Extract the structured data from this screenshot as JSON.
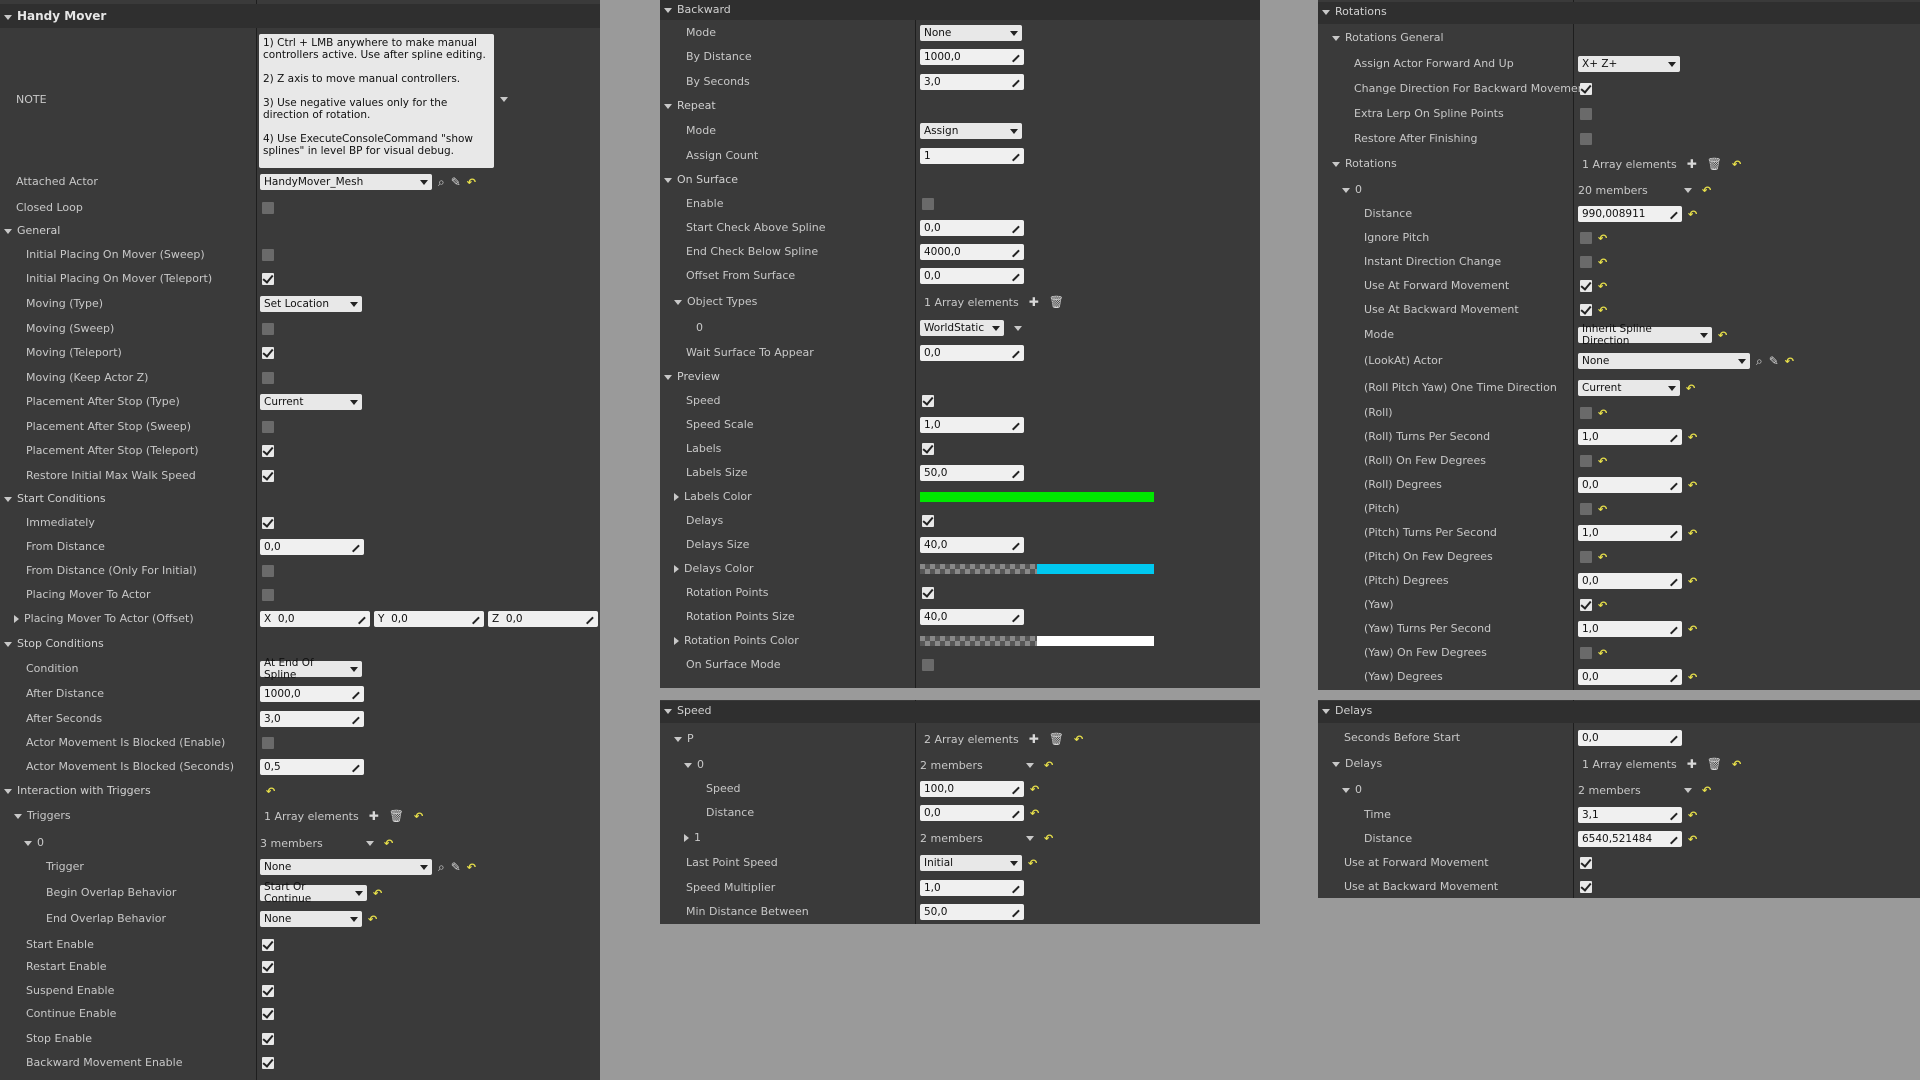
{
  "p1": {
    "title": "Handy Mover",
    "note_label": "NOTE",
    "note_text": "1) Ctrl + LMB anywhere to make manual controllers active. Use after spline editing.\n\n2) Z axis to move manual controllers.\n\n3) Use negative values only for the direction of rotation.\n\n4) Use ExecuteConsoleCommand \"show splines\" in level BP for visual debug.",
    "attached_actor": "Attached Actor",
    "attached_actor_val": "HandyMover_Mesh",
    "closed_loop": "Closed Loop",
    "general": "General",
    "ipm_sweep": "Initial Placing On Mover (Sweep)",
    "ipm_tele": "Initial Placing On Mover (Teleport)",
    "moving_type": "Moving (Type)",
    "moving_type_val": "Set Location",
    "moving_sweep": "Moving (Sweep)",
    "moving_tele": "Moving (Teleport)",
    "moving_keepz": "Moving (Keep Actor Z)",
    "pas_type": "Placement After Stop (Type)",
    "pas_type_val": "Current",
    "pas_sweep": "Placement After Stop (Sweep)",
    "pas_tele": "Placement After Stop (Teleport)",
    "restore_walk": "Restore Initial Max Walk Speed",
    "start_cond": "Start Conditions",
    "immediately": "Immediately",
    "from_dist": "From Distance",
    "from_dist_val": "0,0",
    "from_dist_init": "From Distance (Only For Initial)",
    "placing_to_actor": "Placing Mover To Actor",
    "placing_offset": "Placing Mover To Actor (Offset)",
    "ox": "X",
    "ox_val": "0,0",
    "oy": "Y",
    "oy_val": "0,0",
    "oz": "Z",
    "oz_val": "0,0",
    "stop_cond": "Stop Conditions",
    "condition": "Condition",
    "condition_val": "At End Of Spline",
    "after_dist": "After Distance",
    "after_dist_val": "1000,0",
    "after_sec": "After Seconds",
    "after_sec_val": "3,0",
    "amb_enable": "Actor Movement Is Blocked (Enable)",
    "amb_sec": "Actor Movement Is Blocked (Seconds)",
    "amb_sec_val": "0,5",
    "interaction": "Interaction with Triggers",
    "triggers": "Triggers",
    "triggers_val": "1 Array elements",
    "t0": "0",
    "t0_val": "3 members",
    "trigger": "Trigger",
    "trigger_val": "None",
    "begin_ov": "Begin Overlap Behavior",
    "begin_ov_val": "Start Or Continue",
    "end_ov": "End Overlap Behavior",
    "end_ov_val": "None",
    "start_en": "Start Enable",
    "restart_en": "Restart Enable",
    "suspend_en": "Suspend Enable",
    "continue_en": "Continue Enable",
    "stop_en": "Stop Enable",
    "backward_en": "Backward Movement Enable"
  },
  "p2": {
    "backward": "Backward",
    "mode": "Mode",
    "mode_val": "None",
    "by_dist": "By Distance",
    "by_dist_val": "1000,0",
    "by_sec": "By Seconds",
    "by_sec_val": "3,0",
    "repeat": "Repeat",
    "rmode": "Mode",
    "rmode_val": "Assign",
    "assign_count": "Assign Count",
    "assign_count_val": "1",
    "on_surface": "On Surface",
    "enable": "Enable",
    "start_check": "Start Check Above Spline",
    "start_check_val": "0,0",
    "end_check": "End Check Below Spline",
    "end_check_val": "4000,0",
    "offset_surf": "Offset From Surface",
    "offset_surf_val": "0,0",
    "obj_types": "Object Types",
    "obj_types_val": "1 Array elements",
    "ot0": "0",
    "ot0_val": "WorldStatic",
    "wait_surf": "Wait Surface To Appear",
    "wait_surf_val": "0,0",
    "preview": "Preview",
    "speed": "Speed",
    "speed_scale": "Speed Scale",
    "speed_scale_val": "1,0",
    "labels": "Labels",
    "labels_size": "Labels Size",
    "labels_size_val": "50,0",
    "labels_color": "Labels Color",
    "delays": "Delays",
    "delays_size": "Delays Size",
    "delays_size_val": "40,0",
    "delays_color": "Delays Color",
    "rot_points": "Rotation Points",
    "rot_points_size": "Rotation Points Size",
    "rot_points_size_val": "40,0",
    "rot_points_color": "Rotation Points Color",
    "on_surf_mode": "On Surface Mode",
    "colors": {
      "labels": "#00e600",
      "delays": "#00c8f0",
      "rot": "#ffffff"
    }
  },
  "p3": {
    "speed": "Speed",
    "p": "P",
    "p_val": "2 Array elements",
    "e0": "0",
    "e0_val": "2 members",
    "e0_speed": "Speed",
    "e0_speed_val": "100,0",
    "e0_dist": "Distance",
    "e0_dist_val": "0,0",
    "e1": "1",
    "e1_val": "2 members",
    "last_point": "Last Point Speed",
    "last_point_val": "Initial",
    "speed_mult": "Speed Multiplier",
    "speed_mult_val": "1,0",
    "min_dist": "Min Distance Between",
    "min_dist_val": "50,0"
  },
  "p4": {
    "rotations": "Rotations",
    "rot_general": "Rotations General",
    "assign_fwd": "Assign Actor Forward And Up",
    "assign_fwd_val": "X+  Z+",
    "change_dir": "Change Direction For Backward Movement",
    "extra_lerp": "Extra Lerp On Spline Points",
    "restore_after": "Restore After Finishing",
    "rots": "Rotations",
    "rots_val": "1 Array elements",
    "r0": "0",
    "r0_val": "20 members",
    "distance": "Distance",
    "distance_val": "990,008911",
    "ignore_pitch": "Ignore Pitch",
    "instant_dir": "Instant Direction Change",
    "use_fwd": "Use At Forward Movement",
    "use_bwd": "Use At Backward Movement",
    "mode": "Mode",
    "mode_val": "Inherit Spline Direction",
    "lookat": "(LookAt) Actor",
    "lookat_val": "None",
    "rpy_once": "(Roll Pitch Yaw) One Time Direction",
    "rpy_once_val": "Current",
    "roll": "(Roll)",
    "roll_turns": "(Roll) Turns Per Second",
    "roll_turns_val": "1,0",
    "roll_few": "(Roll) On Few Degrees",
    "roll_deg": "(Roll) Degrees",
    "roll_deg_val": "0,0",
    "pitch": "(Pitch)",
    "pitch_turns": "(Pitch) Turns Per Second",
    "pitch_turns_val": "1,0",
    "pitch_few": "(Pitch) On Few Degrees",
    "pitch_deg": "(Pitch) Degrees",
    "pitch_deg_val": "0,0",
    "yaw": "(Yaw)",
    "yaw_turns": "(Yaw) Turns Per Second",
    "yaw_turns_val": "1,0",
    "yaw_few": "(Yaw) On Few Degrees",
    "yaw_deg": "(Yaw) Degrees",
    "yaw_deg_val": "0,0"
  },
  "p5": {
    "delays": "Delays",
    "sec_before": "Seconds Before Start",
    "sec_before_val": "0,0",
    "d_delays": "Delays",
    "d_delays_val": "1 Array elements",
    "d0": "0",
    "d0_val": "2 members",
    "time": "Time",
    "time_val": "3,1",
    "distance": "Distance",
    "distance_val": "6540,521484",
    "use_fwd": "Use at Forward Movement",
    "use_bwd": "Use at Backward Movement"
  }
}
